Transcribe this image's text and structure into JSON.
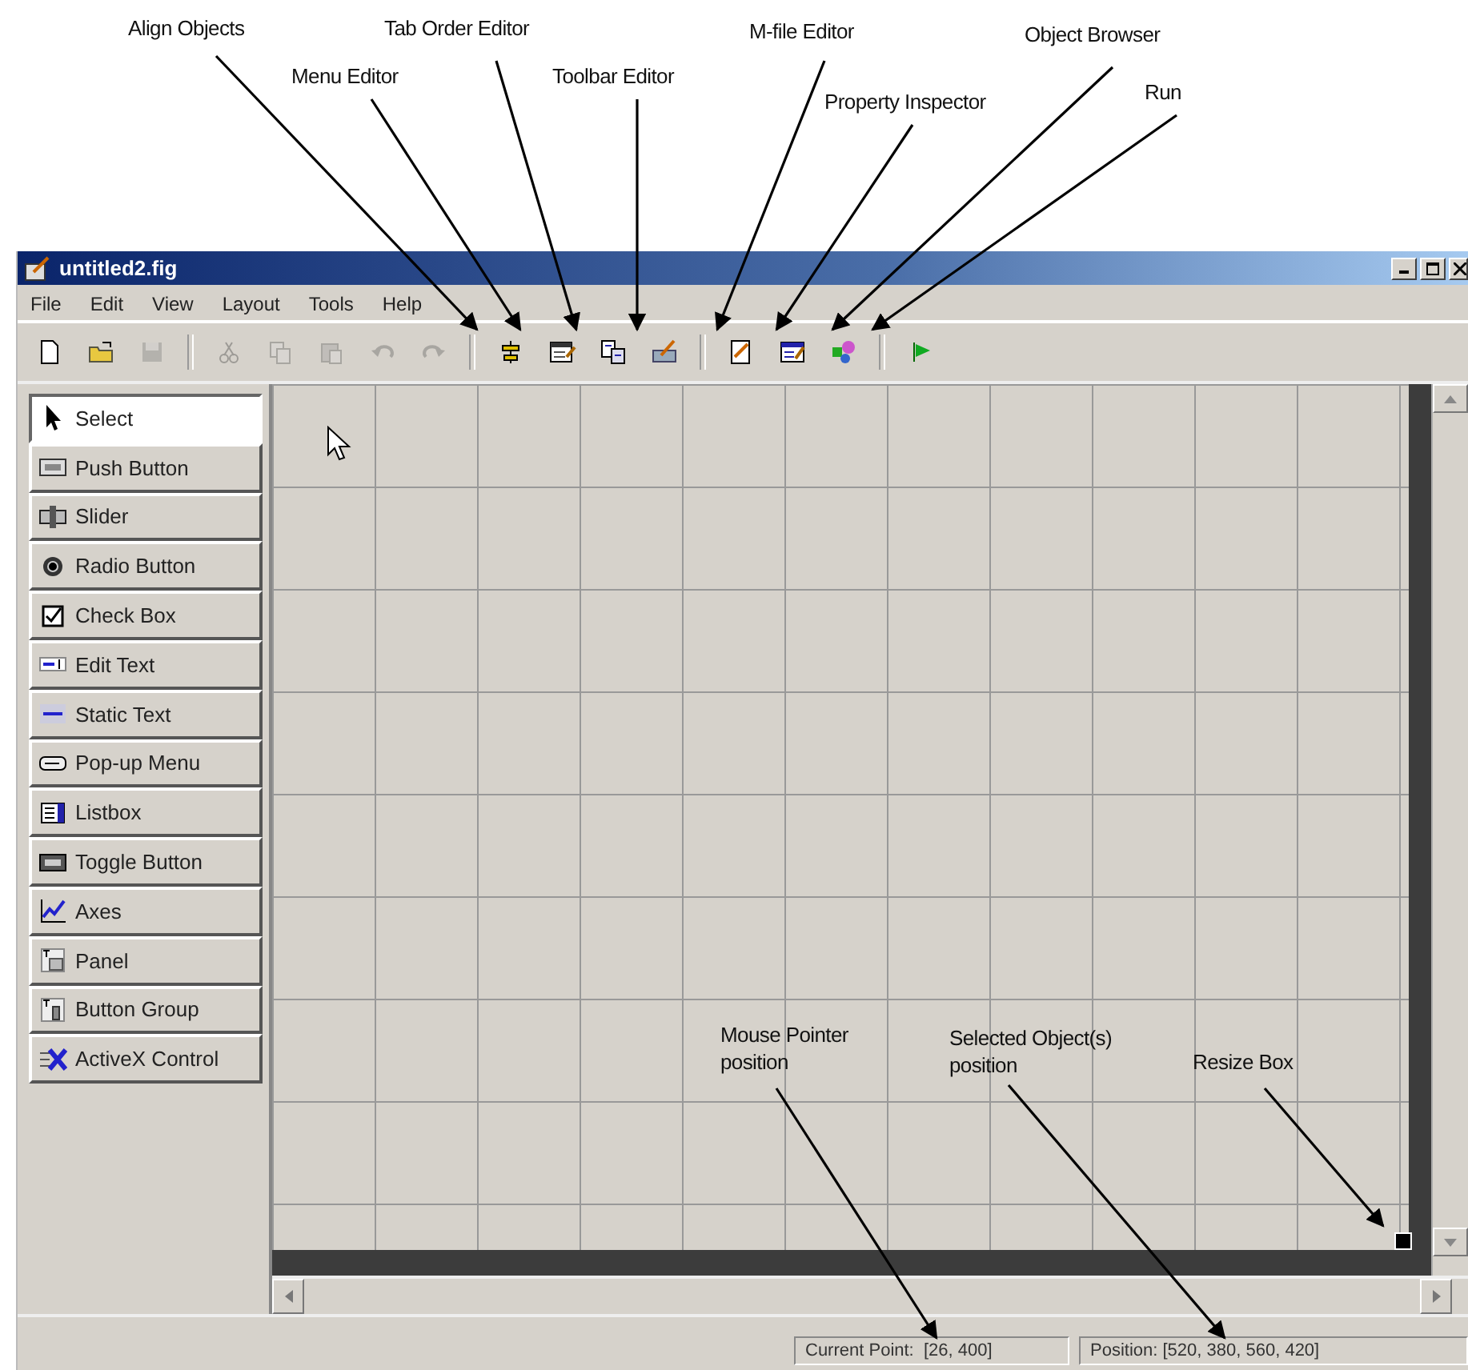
{
  "callouts_top": [
    "Align Objects",
    "Menu Editor",
    "Tab Order Editor",
    "Toolbar Editor",
    "M-file Editor",
    "Property Inspector",
    "Object Browser",
    "Run"
  ],
  "window": {
    "title": "untitled2.fig"
  },
  "menu": [
    "File",
    "Edit",
    "View",
    "Layout",
    "Tools",
    "Help"
  ],
  "toolbar": [
    [
      {
        "kind": "new",
        "enabled": true
      },
      {
        "kind": "open",
        "enabled": true
      },
      {
        "kind": "save",
        "enabled": false
      }
    ],
    [
      {
        "kind": "cut",
        "enabled": false
      },
      {
        "kind": "copy",
        "enabled": false
      },
      {
        "kind": "paste",
        "enabled": false
      },
      {
        "kind": "undo",
        "enabled": false
      },
      {
        "kind": "redo",
        "enabled": false
      }
    ],
    [
      {
        "kind": "align",
        "enabled": true
      },
      {
        "kind": "menu",
        "enabled": true
      },
      {
        "kind": "taborder",
        "enabled": true
      },
      {
        "kind": "toolbar",
        "enabled": true
      }
    ],
    [
      {
        "kind": "mfile",
        "enabled": true
      },
      {
        "kind": "inspector",
        "enabled": true
      },
      {
        "kind": "browser",
        "enabled": true
      }
    ],
    [
      {
        "kind": "run",
        "enabled": true
      }
    ]
  ],
  "palette": [
    {
      "label": "Select",
      "kind": "select",
      "selected": true
    },
    {
      "label": "Push Button",
      "kind": "push",
      "selected": false
    },
    {
      "label": "Slider",
      "kind": "slider",
      "selected": false
    },
    {
      "label": "Radio Button",
      "kind": "radio",
      "selected": false
    },
    {
      "label": "Check Box",
      "kind": "check",
      "selected": false
    },
    {
      "label": "Edit Text",
      "kind": "edit",
      "selected": false
    },
    {
      "label": "Static Text",
      "kind": "static",
      "selected": false
    },
    {
      "label": "Pop-up Menu",
      "kind": "popup",
      "selected": false
    },
    {
      "label": "Listbox",
      "kind": "listbox",
      "selected": false
    },
    {
      "label": "Toggle Button",
      "kind": "toggle",
      "selected": false
    },
    {
      "label": "Axes",
      "kind": "axes",
      "selected": false
    },
    {
      "label": "Panel",
      "kind": "panel",
      "selected": false
    },
    {
      "label": "Button Group",
      "kind": "group",
      "selected": false
    },
    {
      "label": "ActiveX Control",
      "kind": "activex",
      "selected": false
    }
  ],
  "callouts_canvas": [
    "Mouse Pointer\nposition",
    "Selected Object(s)\nposition",
    "Resize Box"
  ],
  "status_bar": {
    "current_point": "Current Point:  [26, 400]",
    "position": "Position: [520, 380, 560, 420]"
  }
}
